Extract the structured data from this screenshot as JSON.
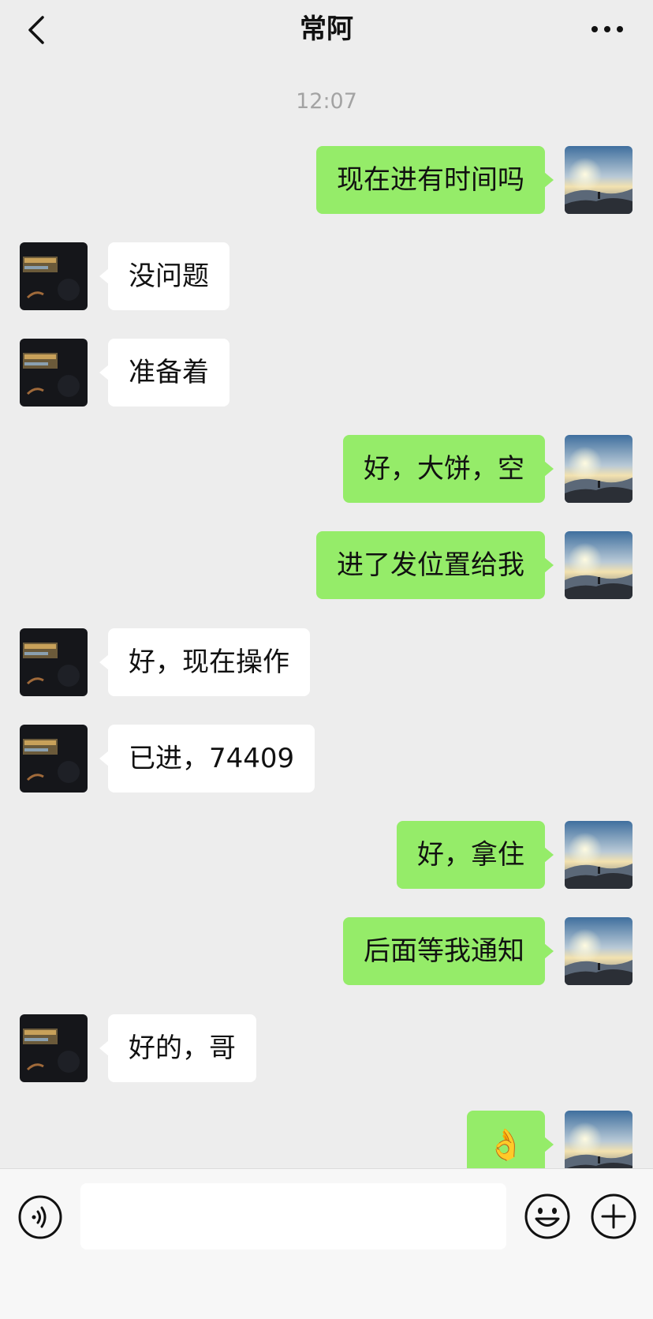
{
  "header": {
    "title": "常阿",
    "back_icon": "chevron-left-icon",
    "more_icon": "more-dots-icon"
  },
  "timestamp": "12:07",
  "messages": [
    {
      "side": "out",
      "text": "现在进有时间吗"
    },
    {
      "side": "in",
      "text": "没问题"
    },
    {
      "side": "in",
      "text": "准备着"
    },
    {
      "side": "out",
      "text": "好，大饼，空"
    },
    {
      "side": "out",
      "text": "进了发位置给我"
    },
    {
      "side": "in",
      "text": "好，现在操作"
    },
    {
      "side": "in",
      "text": "已进，74409"
    },
    {
      "side": "out",
      "text": "好，拿住"
    },
    {
      "side": "out",
      "text": "后面等我通知"
    },
    {
      "side": "in",
      "text": "好的，哥"
    },
    {
      "side": "out",
      "text": "👌"
    }
  ],
  "input_bar": {
    "voice_icon": "voice-icon",
    "input_value": "",
    "emoji_icon": "emoji-icon",
    "plus_icon": "plus-icon"
  },
  "colors": {
    "background": "#ededed",
    "outgoing_bubble": "#95ec69",
    "incoming_bubble": "#ffffff",
    "timestamp": "#a3a3a3"
  }
}
